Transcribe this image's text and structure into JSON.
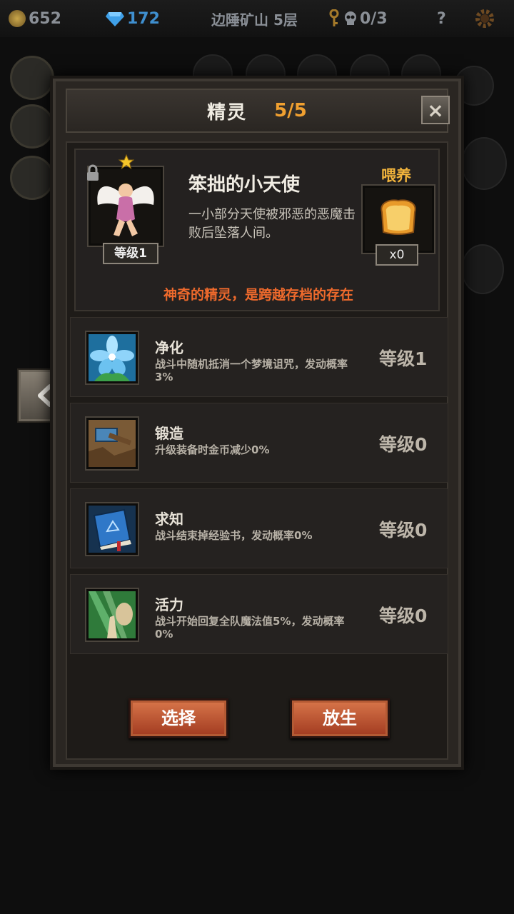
{
  "hud": {
    "coins": "652",
    "gems": "172",
    "location": "边陲矿山 5层",
    "keys_skulls": "0/3",
    "help": "?"
  },
  "panel": {
    "title": "精灵",
    "count": "5/5",
    "close": "×"
  },
  "spirit": {
    "name": "笨拙的小天使",
    "description": "一小部分天使被邪恶的恶魔击败后坠落人间。",
    "level": "等级1",
    "feed_label": "喂养",
    "feed_count": "x0",
    "tagline": "神奇的精灵，是跨越存档的存在"
  },
  "skills": [
    {
      "name": "净化",
      "desc": "战斗中随机抵消一个梦境诅咒，发动概率3%",
      "level": "等级1",
      "icon": "flower-icon"
    },
    {
      "name": "锻造",
      "desc": "升级装备时金币减少0%",
      "level": "等级0",
      "icon": "hammer-icon"
    },
    {
      "name": "求知",
      "desc": "战斗结束掉经验书，发动概率0%",
      "level": "等级0",
      "icon": "book-icon"
    },
    {
      "name": "活力",
      "desc": "战斗开始回复全队魔法值5%，发动概率0%",
      "level": "等级0",
      "icon": "prayer-icon"
    }
  ],
  "buttons": {
    "select": "选择",
    "release": "放生"
  },
  "colors": {
    "accent_orange": "#f0a030",
    "tagline_red": "#ef6a2c",
    "button_red": "#b8482a"
  }
}
